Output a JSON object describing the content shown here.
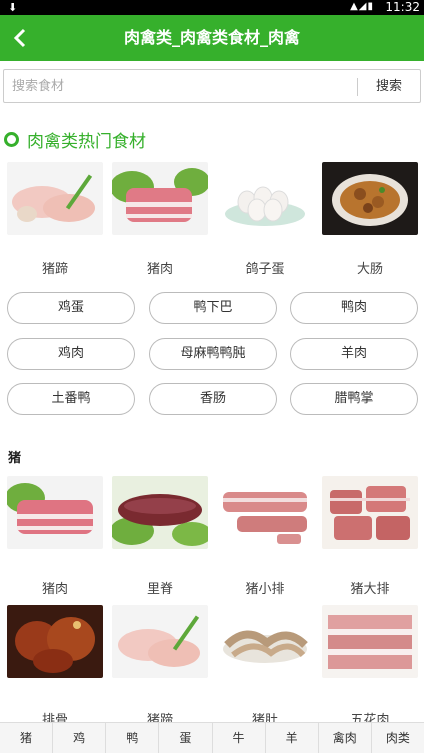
{
  "status": {
    "time": "11:32"
  },
  "header": {
    "title": "肉禽类_肉禽类食材_肉禽"
  },
  "search": {
    "placeholder": "搜索食材",
    "button": "搜索"
  },
  "hot": {
    "title": "肉禽类热门食材",
    "items": [
      "猪蹄",
      "猪肉",
      "鸽子蛋",
      "大肠"
    ],
    "pills": [
      "鸡蛋",
      "鸭下巴",
      "鸭肉",
      "鸡肉",
      "母麻鸭鸭肫",
      "羊肉",
      "土番鸭",
      "香肠",
      "腊鸭掌"
    ]
  },
  "pig": {
    "title": "猪",
    "row1": [
      "猪肉",
      "里脊",
      "猪小排",
      "猪大排"
    ],
    "row2": [
      "排骨",
      "猪蹄",
      "猪肚",
      "五花肉"
    ]
  },
  "bottom": [
    "猪",
    "鸡",
    "鸭",
    "蛋",
    "牛",
    "羊",
    "禽肉",
    "肉类"
  ]
}
